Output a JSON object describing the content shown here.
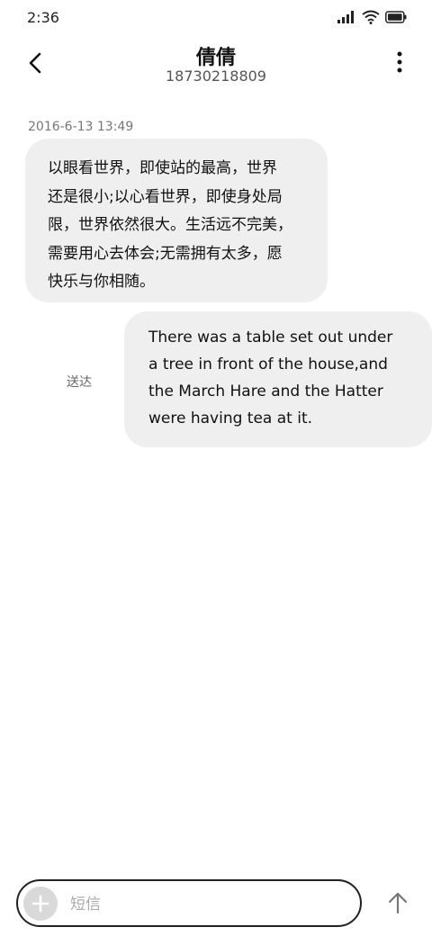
{
  "status_bar": {
    "time": "2:36",
    "icons": [
      "signal-icon",
      "wifi-icon",
      "battery-icon"
    ]
  },
  "header": {
    "contact_name": "倩倩",
    "contact_number": "18730218809",
    "back_icon": "back-arrow-icon",
    "more_icon": "more-vertical-icon"
  },
  "conversation": {
    "timestamp": "2016-6-13 13:49",
    "messages": [
      {
        "direction": "incoming",
        "lines": [
          "以眼看世界，即使站的最高，世界",
          "还是很小;以心看世界，即使身处局",
          "限，世界依然很大。生活远不完美，",
          "需要用心去体会;无需拥有太多，愿",
          "快乐与你相随。"
        ]
      },
      {
        "direction": "outgoing",
        "status": "送达",
        "lines": [
          "There was a table set out under",
          "a tree in front of the house,and",
          "the March Hare and the Hatter",
          "were having tea at it."
        ]
      }
    ]
  },
  "composer": {
    "placeholder": "短信",
    "value": "",
    "add_icon": "plus-icon",
    "send_icon": "send-arrow-up-icon"
  },
  "colors": {
    "bubble_background": "#efefef",
    "composer_border": "#222222",
    "secondary_text": "#777777"
  }
}
